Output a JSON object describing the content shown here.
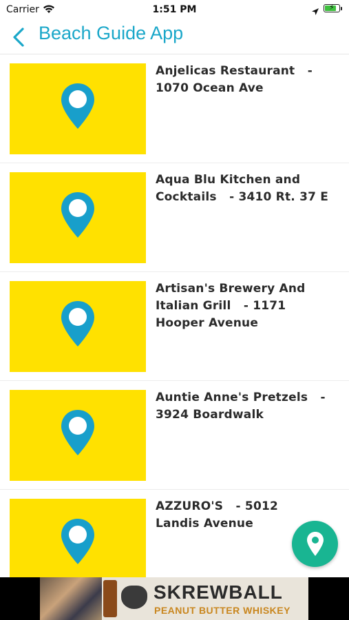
{
  "status_bar": {
    "carrier": "Carrier",
    "time": "1:51 PM"
  },
  "nav": {
    "title": "Beach Guide App",
    "accent_color": "#1aa7c9"
  },
  "listings": [
    {
      "name": "Anjelicas Restaurant   - 1070 Ocean Ave"
    },
    {
      "name": "Aqua Blu Kitchen and Cocktails   - 3410 Rt. 37 E"
    },
    {
      "name": "Artisan's Brewery And Italian Grill   - 1171  Hooper Avenue"
    },
    {
      "name": "Auntie Anne's Pretzels   - 3924 Boardwalk"
    },
    {
      "name": "AZZURO'S   - 5012\nLandis Avenue"
    }
  ],
  "thumbnail": {
    "background": "#ffe100",
    "pin_color": "#189fcb",
    "icon": "map-pin-icon"
  },
  "fab": {
    "icon": "map-pin-icon",
    "color": "#19b592"
  },
  "ad": {
    "brand": "SKREWBALL",
    "tagline": "PEANUT BUTTER WHISKEY"
  }
}
